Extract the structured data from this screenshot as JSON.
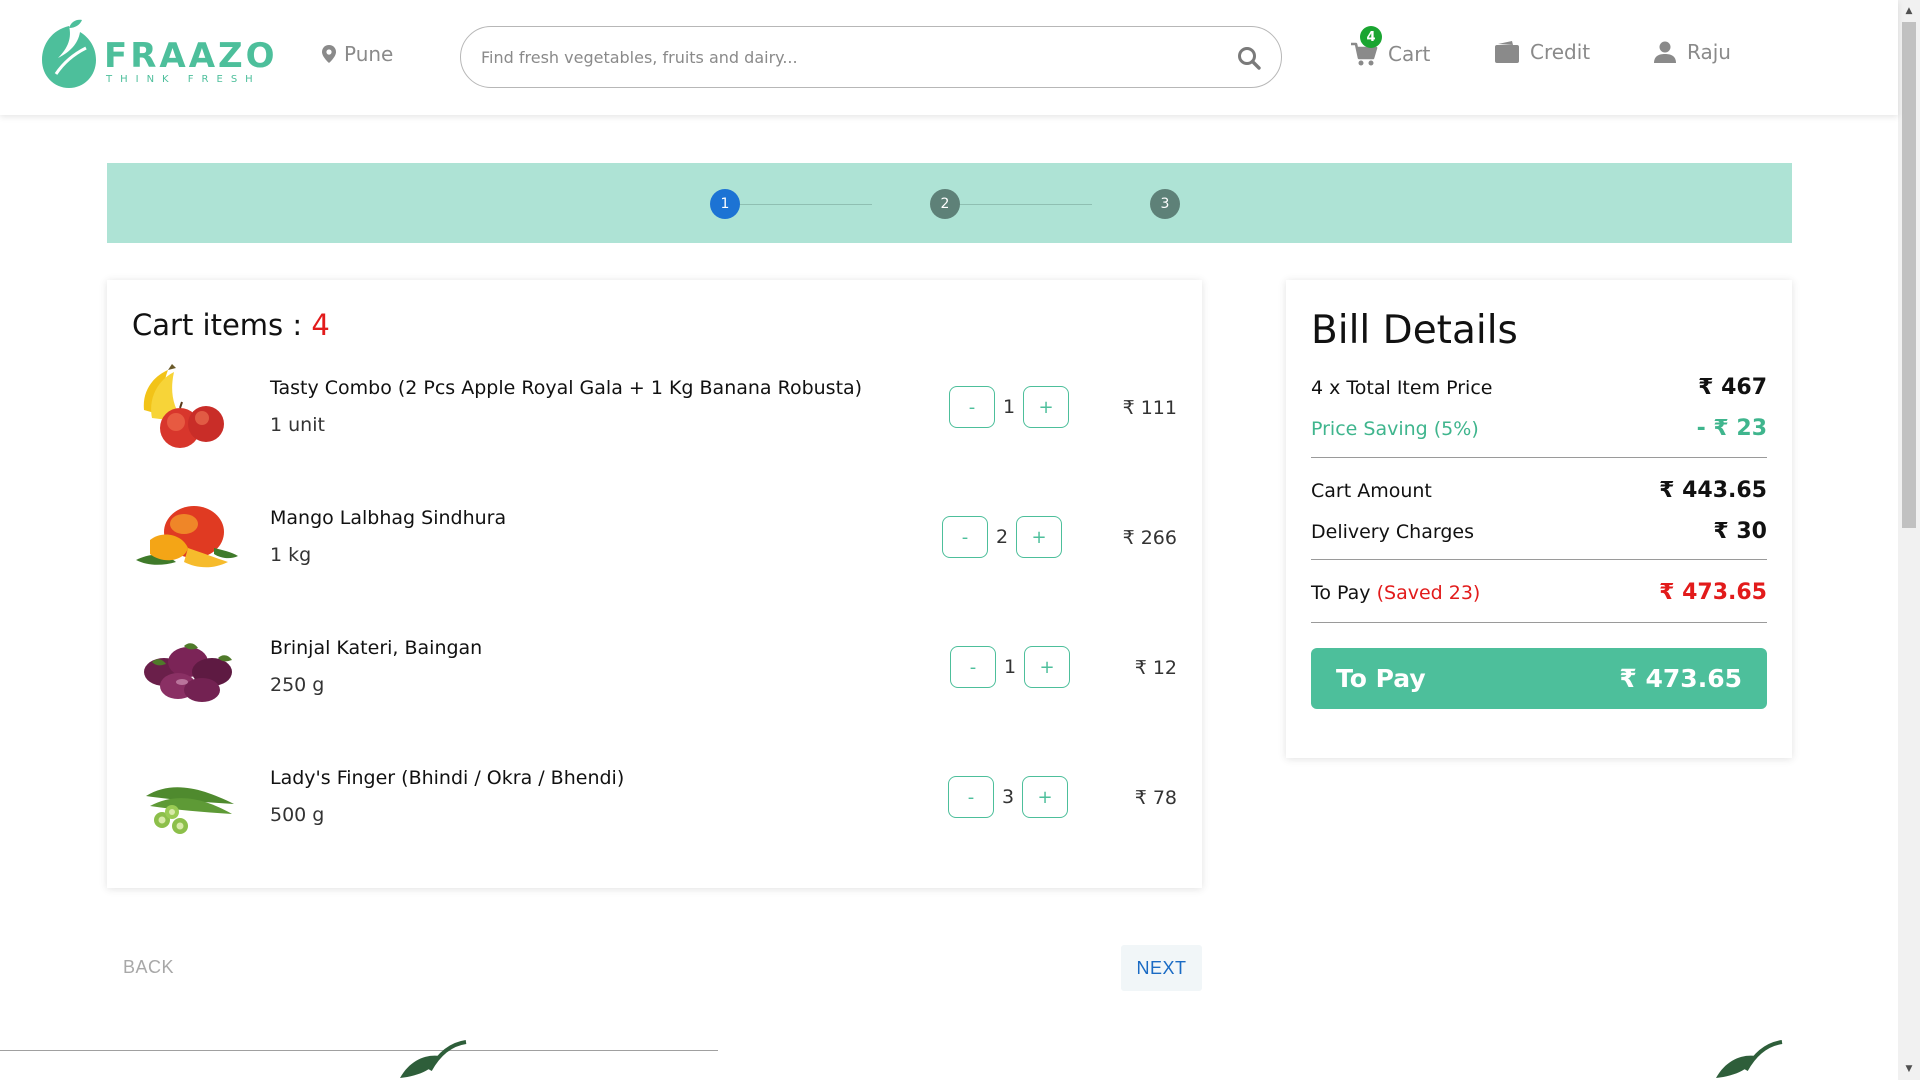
{
  "header": {
    "logo_word": "FRAAZO",
    "logo_tagline": "THINK FRESH",
    "location": "Pune",
    "search_placeholder": "Find fresh vegetables, fruits and dairy...",
    "cart_label": "Cart",
    "cart_badge": "4",
    "credit_label": "Credit",
    "user_label": "Raju"
  },
  "stepper": {
    "steps": [
      "1",
      "2",
      "3"
    ],
    "active_step": 1
  },
  "cart": {
    "title": "Cart items : ",
    "count": "4",
    "items": [
      {
        "name": "Tasty Combo (2 Pcs Apple Royal Gala + 1 Kg Banana Robusta)",
        "unit": "1 unit",
        "qty": "1",
        "price": "₹ 111",
        "image": "fruit-combo-image"
      },
      {
        "name": "Mango Lalbhag Sindhura",
        "unit": "1 kg",
        "qty": "2",
        "price": "₹ 266",
        "image": "mango-image"
      },
      {
        "name": "Brinjal Kateri, Baingan",
        "unit": "250 g",
        "qty": "1",
        "price": "₹ 12",
        "image": "brinjal-image"
      },
      {
        "name": "Lady's Finger (Bhindi / Okra / Bhendi)",
        "unit": "500 g",
        "qty": "3",
        "price": "₹ 78",
        "image": "okra-image"
      }
    ],
    "minus_label": "-",
    "plus_label": "+"
  },
  "bill": {
    "title": "Bill Details",
    "total_item_label": "4 x Total Item Price",
    "total_item_value": "₹ 467",
    "saving_label": "Price Saving (5%)",
    "saving_value": "- ₹ 23",
    "cart_amount_label": "Cart Amount",
    "cart_amount_value": "₹ 443.65",
    "delivery_label": "Delivery Charges",
    "delivery_value": "₹ 30",
    "to_pay_label": "To Pay",
    "to_pay_saved": "(Saved 23)",
    "to_pay_value": "₹ 473.65",
    "pay_button_label": "To Pay",
    "pay_button_value": "₹ 473.65"
  },
  "footer_nav": {
    "back_label": "BACK",
    "next_label": "NEXT"
  },
  "colors": {
    "brand": "#4dbf9b",
    "stepper_bg": "#aee3d5",
    "active_step": "#1c73d4",
    "alert": "#e21b1b",
    "badge": "#1aa531"
  },
  "icons": {
    "location": "map-pin-icon",
    "search": "search-icon",
    "cart": "cart-icon",
    "credit": "wallet-icon",
    "user": "user-icon"
  }
}
